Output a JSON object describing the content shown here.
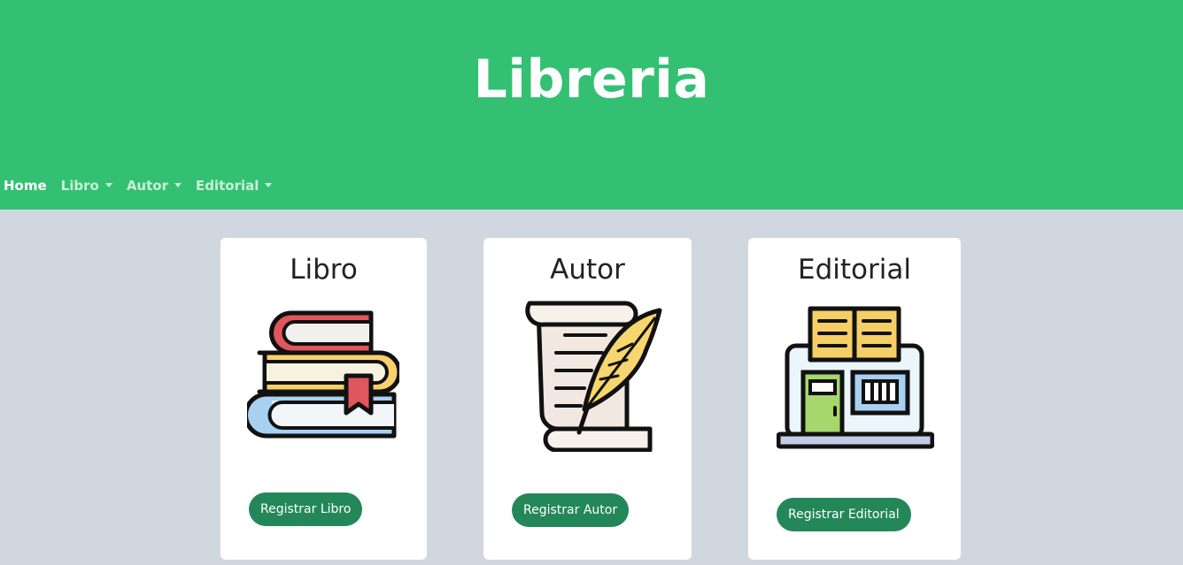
{
  "header": {
    "title": "Libreria",
    "bg_color": "#33c072"
  },
  "nav": {
    "home": "Home",
    "libro": "Libro",
    "autor": "Autor",
    "editorial": "Editorial"
  },
  "cards": [
    {
      "title": "Libro",
      "button": "Registrar Libro",
      "icon": "books-icon"
    },
    {
      "title": "Autor",
      "button": "Registrar Autor",
      "icon": "scroll-quill-icon"
    },
    {
      "title": "Editorial",
      "button": "Registrar Editorial",
      "icon": "bookstore-icon"
    }
  ],
  "colors": {
    "page_bg": "#d1d7df",
    "button": "#23875a"
  }
}
